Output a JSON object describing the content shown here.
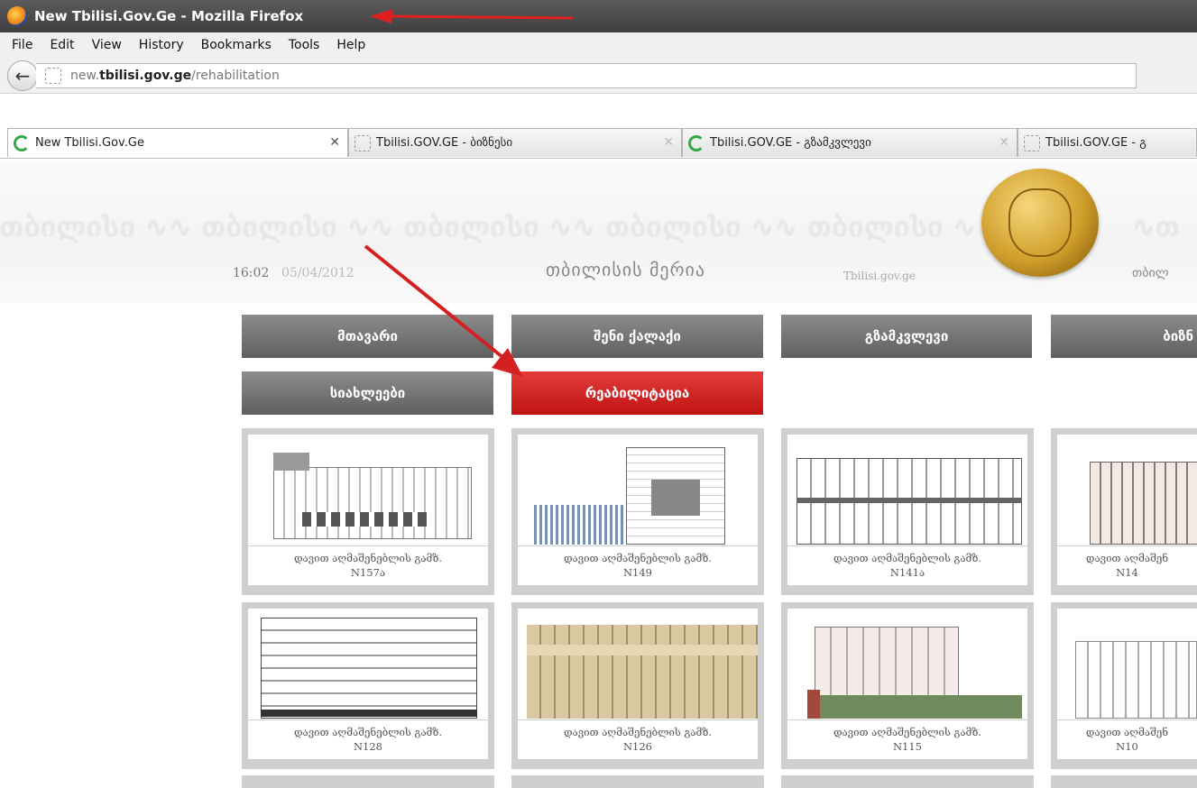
{
  "window": {
    "title": "New Tbilisi.Gov.Ge - Mozilla Firefox"
  },
  "menu": [
    "File",
    "Edit",
    "View",
    "History",
    "Bookmarks",
    "Tools",
    "Help"
  ],
  "url": {
    "host_prefix": "new.",
    "host": "tbilisi.gov.ge",
    "path": "/rehabilitation"
  },
  "tabs": [
    {
      "label": "New Tbilisi.Gov.Ge",
      "icon": "green-loading-icon"
    },
    {
      "label": "Tbilisi.GOV.GE - ბიზნესი",
      "icon": "blank-page-icon"
    },
    {
      "label": "Tbilisi.GOV.GE - გზამკვლევი",
      "icon": "green-loading-icon"
    },
    {
      "label": "Tbilisi.GOV.GE - გ",
      "icon": "blank-page-icon"
    }
  ],
  "banner": {
    "time": "16:02",
    "date": "05/04/2012",
    "mayor": "თბილისის მერია",
    "site": "Tbilisi.gov.ge",
    "mayor_cut": "თბილ"
  },
  "nav": [
    {
      "label": "მთავარი"
    },
    {
      "label": "შენი ქალაქი"
    },
    {
      "label": "გზამკვლევი"
    },
    {
      "label": "ბიზნ"
    },
    {
      "label": "სიახლეები"
    },
    {
      "label": "რეაბილიტაცია"
    }
  ],
  "cards": [
    {
      "line1": "დავით აღმაშენებლის გამზ.",
      "line2": "N157ა"
    },
    {
      "line1": "დავით აღმაშენებლის გამზ.",
      "line2": "N149"
    },
    {
      "line1": "დავით აღმაშენებლის გამზ.",
      "line2": "N141ა"
    },
    {
      "line1": "დავით აღმაშენ",
      "line2": "N14"
    },
    {
      "line1": "დავით აღმაშენებლის გამზ.",
      "line2": "N128"
    },
    {
      "line1": "დავით აღმაშენებლის გამზ.",
      "line2": "N126"
    },
    {
      "line1": "დავით აღმაშენებლის გამზ.",
      "line2": "N115"
    },
    {
      "line1": "დავით აღმაშენ",
      "line2": "N10"
    }
  ],
  "colors": {
    "active_nav": "#c81818",
    "nav": "#6e6e6e",
    "annotation_arrow": "#d42020"
  }
}
